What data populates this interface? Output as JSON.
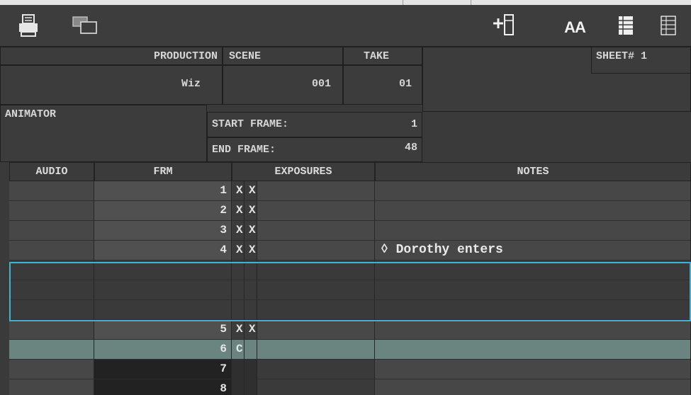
{
  "toolbar": {
    "print_icon": "printer-icon",
    "window_icon": "window-icon",
    "add_page_icon": "add-page-icon",
    "font_size_label": "AA",
    "list_view_icon": "list-view-icon",
    "grid_view_icon": "grid-view-icon"
  },
  "header": {
    "production_label": "PRODUCTION",
    "production_value": "Wiz",
    "scene_label": "SCENE",
    "scene_value": "001",
    "take_label": "TAKE",
    "take_value": "01",
    "sheet_label": "SHEET# 1",
    "animator_label": "ANIMATOR",
    "start_frame_label": "START FRAME:",
    "start_frame_value": "1",
    "end_frame_label": "END FRAME:",
    "end_frame_value": "48"
  },
  "columns": {
    "audio": "AUDIO",
    "frm": "FRM",
    "exposures": "EXPOSURES",
    "notes": "NOTES"
  },
  "rows": [
    {
      "frm": "1",
      "exp": [
        "X",
        "X"
      ],
      "note": ""
    },
    {
      "frm": "2",
      "exp": [
        "X",
        "X"
      ],
      "note": ""
    },
    {
      "frm": "3",
      "exp": [
        "X",
        "X"
      ],
      "note": ""
    },
    {
      "frm": "4",
      "exp": [
        "X",
        "X"
      ],
      "note": "◊ Dorothy enters"
    },
    {
      "frm": "",
      "exp": [
        "",
        ""
      ],
      "note": ""
    },
    {
      "frm": "",
      "exp": [
        "",
        ""
      ],
      "note": ""
    },
    {
      "frm": "",
      "exp": [
        "",
        ""
      ],
      "note": ""
    },
    {
      "frm": "5",
      "exp": [
        "X",
        "X"
      ],
      "note": ""
    },
    {
      "frm": "6",
      "exp": [
        "C",
        ""
      ],
      "note": ""
    },
    {
      "frm": "7",
      "exp": [
        "",
        ""
      ],
      "note": ""
    },
    {
      "frm": "8",
      "exp": [
        "",
        ""
      ],
      "note": ""
    }
  ],
  "colors": {
    "background": "#3a3a3a",
    "selection_row": "#6a8580",
    "insert_outline": "#3fb2d3"
  }
}
